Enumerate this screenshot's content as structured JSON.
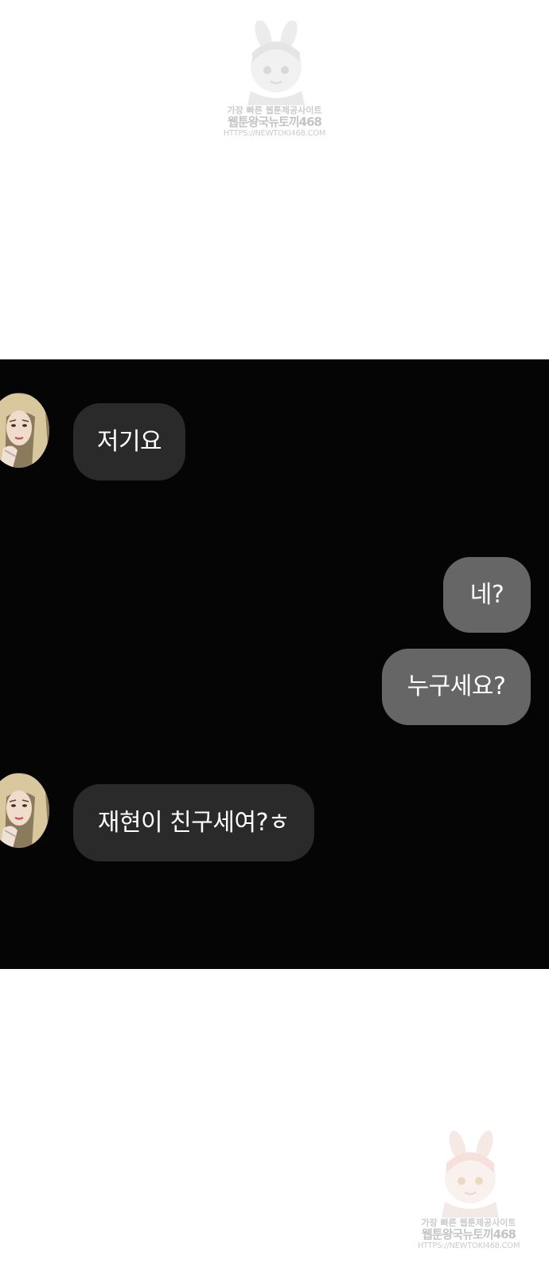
{
  "watermark_top": {
    "line1": "가장 빠른 웹툰제공사이트",
    "line2": "웹툰왕국뉴토끼468",
    "line3": "HTTPS://NEWTOKI468.COM"
  },
  "watermark_bottom": {
    "line1": "가장 빠른 웹툰제공사이트",
    "line2": "웹툰왕국뉴토끼468",
    "line3": "HTTPS://NEWTOKI468.COM"
  },
  "conversation": {
    "messages": [
      {
        "sender": "other",
        "text": "저기요"
      },
      {
        "sender": "me",
        "text": "네?"
      },
      {
        "sender": "me",
        "text": "누구세요?"
      },
      {
        "sender": "other",
        "text": "재현이 친구세여?ㅎ"
      }
    ]
  },
  "colors": {
    "panel_background": "#050505",
    "incoming_bubble": "#2a2a2a",
    "outgoing_bubble": "#666666",
    "bubble_text": "#ffffff",
    "page_background": "#ffffff"
  },
  "icons": {
    "avatar": "woman-blonde-portrait-icon",
    "watermark_mascot": "bunny-girl-mascot-icon"
  }
}
